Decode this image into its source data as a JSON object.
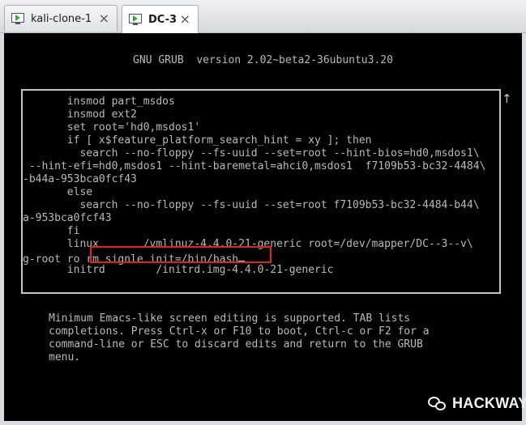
{
  "tabs": [
    {
      "label": "kali-clone-1",
      "icon": "vm-play-icon",
      "active": false
    },
    {
      "label": "DC-3",
      "icon": "vm-play-icon",
      "active": true
    }
  ],
  "close_glyph": "×",
  "grub": {
    "header": "GNU GRUB  version 2.02~beta2-36ubuntu3.20",
    "lines": [
      "       insmod part_msdos",
      "       insmod ext2",
      "       set root='hd0,msdos1'",
      "       if [ x$feature_platform_search_hint = xy ]; then",
      "         search --no-floppy --fs-uuid --set=root --hint-bios=hd0,msdos1\\",
      " --hint-efi=hd0,msdos1 --hint-baremetal=ahci0,msdos1  f7109b53-bc32-4484\\",
      "-b44a-953bca0fcf43",
      "       else",
      "         search --no-floppy --fs-uuid --set=root f7109b53-bc32-4484-b44\\",
      "a-953bca0fcf43",
      "       fi",
      "       linux       /vmlinuz-4.4.0-21-generic root=/dev/mapper/DC--3--v\\"
    ],
    "edit_line_prefix": "g-root ro ",
    "edit_line_typed": "rm signle init=/bin/bash",
    "last_line": "       initrd        /initrd.img-4.4.0-21-generic",
    "scroll_indicator": "↑",
    "help_text": "Minimum Emacs-like screen editing is supported. TAB lists\ncompletions. Press Ctrl-x or F10 to boot, Ctrl-c or F2 for a\ncommand-line or ESC to discard edits and return to the GRUB\nmenu."
  },
  "watermark": {
    "text": "HACKWAY",
    "icon": "wechat-icon"
  },
  "colors": {
    "console_bg": "#000000",
    "text": "#b9b9b9",
    "highlight_border": "#e02020"
  }
}
